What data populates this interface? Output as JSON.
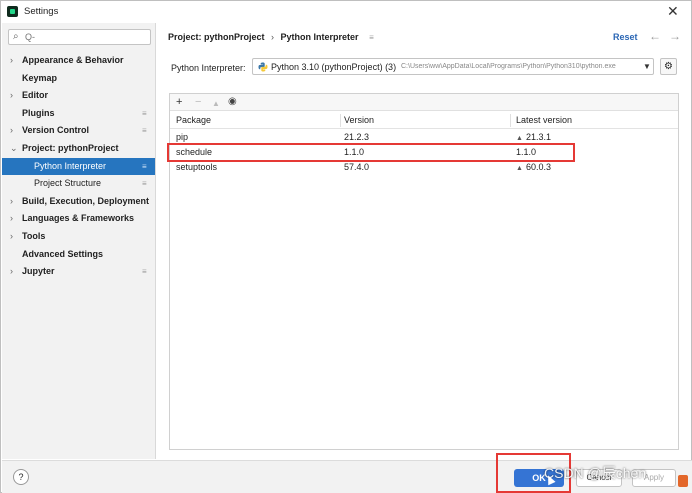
{
  "window": {
    "title": "Settings"
  },
  "sidebar": {
    "search_placeholder": "Q-",
    "items": [
      {
        "label": "Appearance & Behavior",
        "arrow": "›"
      },
      {
        "label": "Keymap"
      },
      {
        "label": "Editor",
        "arrow": "›"
      },
      {
        "label": "Plugins",
        "pin": "≡"
      },
      {
        "label": "Version Control",
        "arrow": "›",
        "pin": "≡"
      },
      {
        "label": "Project: pythonProject",
        "arrow": "⌄"
      },
      {
        "label": "Python Interpreter",
        "pin": "≡",
        "selected": true
      },
      {
        "label": "Project Structure",
        "pin": "≡"
      },
      {
        "label": "Build, Execution, Deployment",
        "arrow": "›"
      },
      {
        "label": "Languages & Frameworks",
        "arrow": "›"
      },
      {
        "label": "Tools",
        "arrow": "›"
      },
      {
        "label": "Advanced Settings"
      },
      {
        "label": "Jupyter",
        "arrow": "›",
        "pin": "≡"
      }
    ]
  },
  "header": {
    "breadcrumb_project": "Project: pythonProject",
    "breadcrumb_sep": "›",
    "breadcrumb_page": "Python Interpreter",
    "reset_label": "Reset"
  },
  "interpreter": {
    "label": "Python Interpreter:",
    "name": "Python 3.10 (pythonProject) (3)",
    "path": "C:\\Users\\ww\\AppData\\Local\\Programs\\Python\\Python310\\python.exe"
  },
  "packages": {
    "columns": [
      "Package",
      "Version",
      "Latest version"
    ],
    "rows": [
      {
        "package": "pip",
        "version": "21.2.3",
        "latest": "21.3.1",
        "upgrade": true
      },
      {
        "package": "schedule",
        "version": "1.1.0",
        "latest": "1.1.0",
        "upgrade": false
      },
      {
        "package": "setuptools",
        "version": "57.4.0",
        "latest": "60.0.3",
        "upgrade": true
      }
    ]
  },
  "footer": {
    "help_label": "?",
    "ok_label": "OK",
    "cancel_label": "Cancel",
    "apply_label": "Apply"
  },
  "watermark": "CSDN @辰chen",
  "colors": {
    "selection": "#2675bf",
    "link": "#2a66b4",
    "primary_button": "#3574d4",
    "highlight_box": "#e53935"
  }
}
